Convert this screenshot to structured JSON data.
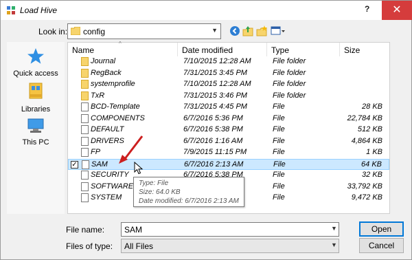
{
  "window": {
    "title": "Load Hive",
    "help_label": "?",
    "close_label": "✕"
  },
  "lookin": {
    "label": "Look in:",
    "value": "config"
  },
  "toolbar": {
    "icons": [
      "back-icon",
      "up-folder-icon",
      "new-folder-icon",
      "view-menu-icon"
    ]
  },
  "places": [
    {
      "label": "Quick access",
      "icon": "star-icon"
    },
    {
      "label": "Libraries",
      "icon": "libraries-icon"
    },
    {
      "label": "This PC",
      "icon": "computer-icon"
    }
  ],
  "columns": {
    "name": "Name",
    "date": "Date modified",
    "type": "Type",
    "size": "Size"
  },
  "files": [
    {
      "name": "Journal",
      "date": "7/10/2015 12:28 AM",
      "type": "File folder",
      "size": "",
      "kind": "folder"
    },
    {
      "name": "RegBack",
      "date": "7/31/2015 3:45 PM",
      "type": "File folder",
      "size": "",
      "kind": "folder"
    },
    {
      "name": "systemprofile",
      "date": "7/10/2015 12:28 AM",
      "type": "File folder",
      "size": "",
      "kind": "folder"
    },
    {
      "name": "TxR",
      "date": "7/31/2015 3:46 PM",
      "type": "File folder",
      "size": "",
      "kind": "folder"
    },
    {
      "name": "BCD-Template",
      "date": "7/31/2015 4:45 PM",
      "type": "File",
      "size": "28 KB",
      "kind": "file"
    },
    {
      "name": "COMPONENTS",
      "date": "6/7/2016 5:36 PM",
      "type": "File",
      "size": "22,784 KB",
      "kind": "file"
    },
    {
      "name": "DEFAULT",
      "date": "6/7/2016 5:38 PM",
      "type": "File",
      "size": "512 KB",
      "kind": "file"
    },
    {
      "name": "DRIVERS",
      "date": "6/7/2016 1:16 AM",
      "type": "File",
      "size": "4,864 KB",
      "kind": "file"
    },
    {
      "name": "FP",
      "date": "7/9/2015 11:15 PM",
      "type": "File",
      "size": "1 KB",
      "kind": "file"
    },
    {
      "name": "SAM",
      "date": "6/7/2016 2:13 AM",
      "type": "File",
      "size": "64 KB",
      "kind": "file",
      "selected": true
    },
    {
      "name": "SECURITY",
      "date": "6/7/2016 5:38 PM",
      "type": "File",
      "size": "32 KB",
      "kind": "file"
    },
    {
      "name": "SOFTWARE",
      "date": "",
      "type": "File",
      "size": "33,792 KB",
      "kind": "file"
    },
    {
      "name": "SYSTEM",
      "date": "",
      "type": "File",
      "size": "9,472 KB",
      "kind": "file"
    }
  ],
  "tooltip": {
    "line1": "Type: File",
    "line2": "Size: 64.0 KB",
    "line3": "Date modified: 6/7/2016 2:13 AM"
  },
  "filename": {
    "label": "File name:",
    "value": "SAM"
  },
  "filetype": {
    "label": "Files of type:",
    "value": "All Files"
  },
  "buttons": {
    "open": "Open",
    "cancel": "Cancel"
  },
  "colors": {
    "selection": "#cce8ff",
    "close_red": "#d53c3c",
    "annotation_arrow": "#cc1f1f",
    "default_button": "#0078d7"
  }
}
